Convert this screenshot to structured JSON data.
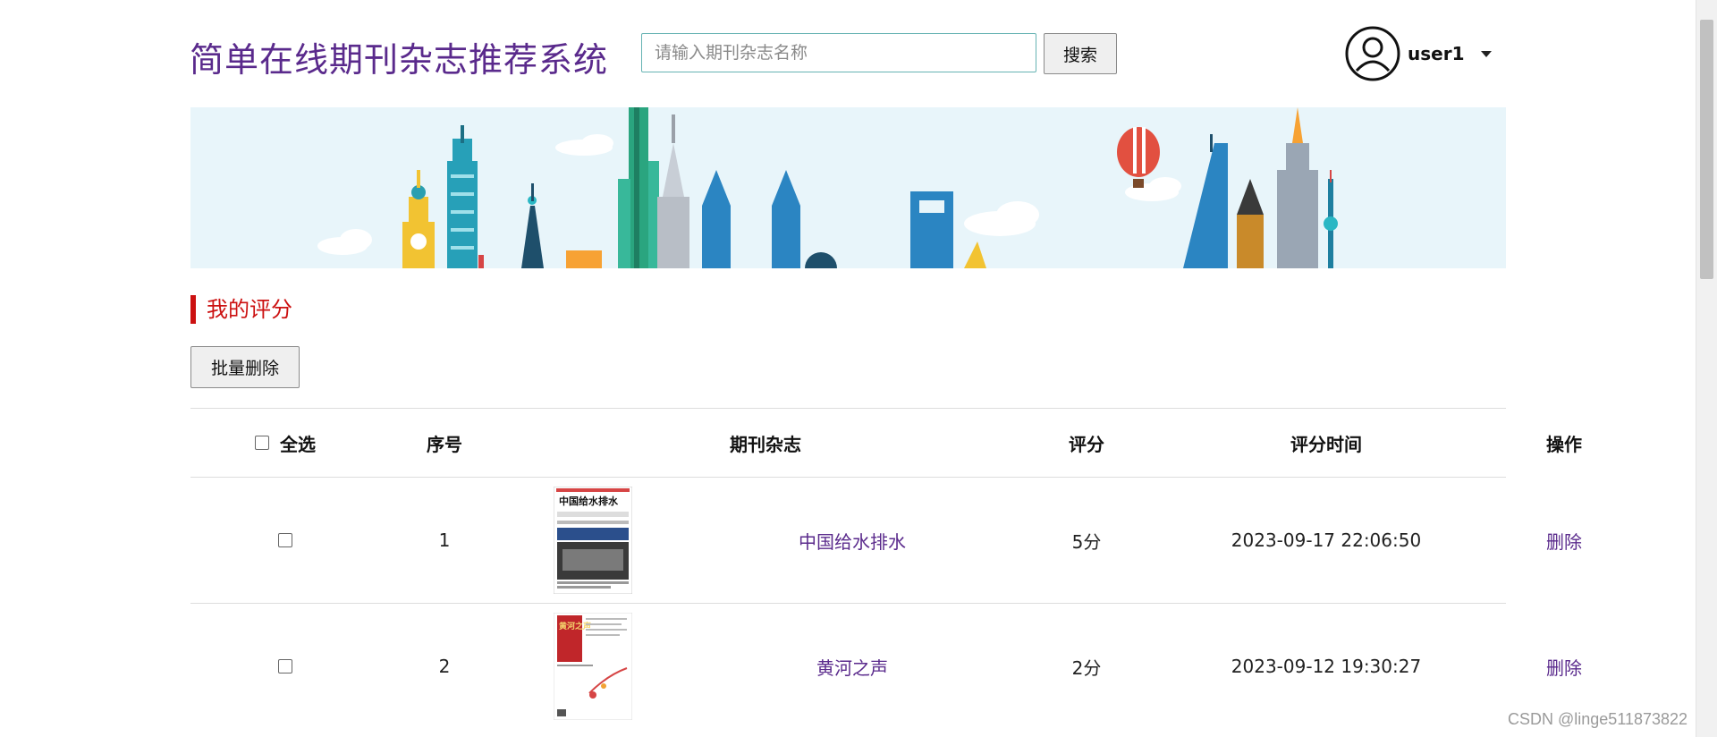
{
  "header": {
    "site_title": "简单在线期刊杂志推荐系统",
    "search_placeholder": "请输入期刊杂志名称",
    "search_value": "",
    "search_button": "搜索",
    "username": "user1"
  },
  "banner": {
    "icon": "city-skyline-banner"
  },
  "section": {
    "title": "我的评分",
    "batch_delete": "批量删除"
  },
  "table": {
    "columns": [
      "全选",
      "序号",
      "期刊杂志",
      "评分",
      "评分时间",
      "操作"
    ],
    "rows": [
      {
        "index": "1",
        "cover_masthead": "中国给水排水",
        "magazine": "中国给水排水",
        "score": "5分",
        "time": "2023-09-17 22:06:50",
        "action": "删除"
      },
      {
        "index": "2",
        "cover_masthead": "黄河之声",
        "magazine": "黄河之声",
        "score": "2分",
        "time": "2023-09-12 19:30:27",
        "action": "删除"
      }
    ]
  },
  "watermark": "CSDN @linge511873822",
  "colors": {
    "title": "#5a2a8c",
    "link": "#5a2a8c",
    "section_accent": "#cc1111",
    "banner_bg": "#e8f5fa"
  }
}
